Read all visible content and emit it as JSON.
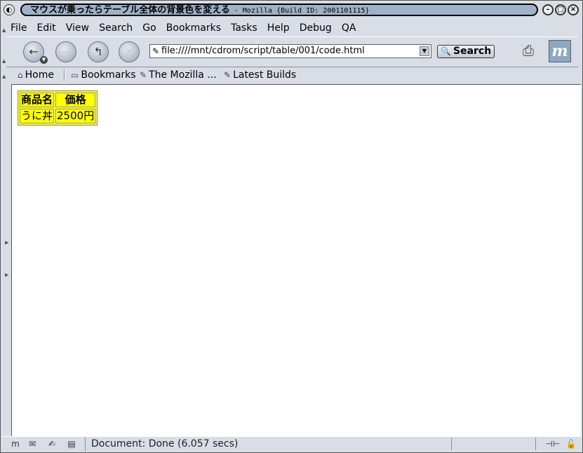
{
  "window": {
    "title": "マウスが乗ったらテーブル全体の背景色を変える",
    "title_suffix": " - Mozilla {Build ID: 2001101115}"
  },
  "menubar": {
    "items": [
      "File",
      "Edit",
      "View",
      "Search",
      "Go",
      "Bookmarks",
      "Tasks",
      "Help",
      "Debug",
      "QA"
    ]
  },
  "navbar": {
    "url": "file:////mnt/cdrom/script/table/001/code.html",
    "search_label": "Search"
  },
  "personal_toolbar": {
    "items": [
      "Home",
      "Bookmarks",
      "The Mozilla ...",
      "Latest Builds"
    ]
  },
  "content": {
    "table": {
      "headers": [
        "商品名",
        "価格"
      ],
      "rows": [
        [
          "うに丼",
          "2500円"
        ]
      ],
      "background": "#ffff00"
    }
  },
  "statusbar": {
    "text": "Document: Done (6.057 secs)"
  }
}
